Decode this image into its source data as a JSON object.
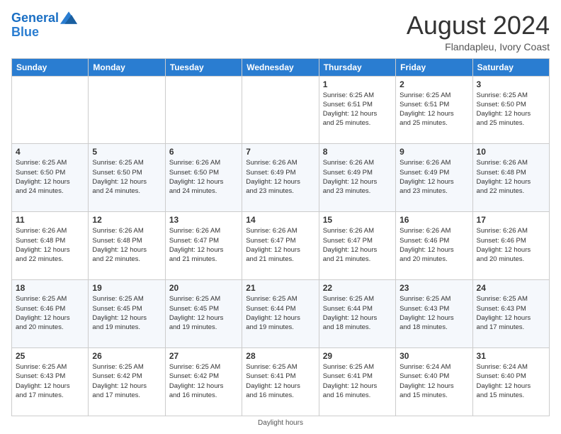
{
  "header": {
    "logo_line1": "General",
    "logo_line2": "Blue",
    "month_year": "August 2024",
    "location": "Flandapleu, Ivory Coast"
  },
  "days_of_week": [
    "Sunday",
    "Monday",
    "Tuesday",
    "Wednesday",
    "Thursday",
    "Friday",
    "Saturday"
  ],
  "weeks": [
    [
      {
        "day": "",
        "info": ""
      },
      {
        "day": "",
        "info": ""
      },
      {
        "day": "",
        "info": ""
      },
      {
        "day": "",
        "info": ""
      },
      {
        "day": "1",
        "info": "Sunrise: 6:25 AM\nSunset: 6:51 PM\nDaylight: 12 hours\nand 25 minutes."
      },
      {
        "day": "2",
        "info": "Sunrise: 6:25 AM\nSunset: 6:51 PM\nDaylight: 12 hours\nand 25 minutes."
      },
      {
        "day": "3",
        "info": "Sunrise: 6:25 AM\nSunset: 6:50 PM\nDaylight: 12 hours\nand 25 minutes."
      }
    ],
    [
      {
        "day": "4",
        "info": "Sunrise: 6:25 AM\nSunset: 6:50 PM\nDaylight: 12 hours\nand 24 minutes."
      },
      {
        "day": "5",
        "info": "Sunrise: 6:25 AM\nSunset: 6:50 PM\nDaylight: 12 hours\nand 24 minutes."
      },
      {
        "day": "6",
        "info": "Sunrise: 6:26 AM\nSunset: 6:50 PM\nDaylight: 12 hours\nand 24 minutes."
      },
      {
        "day": "7",
        "info": "Sunrise: 6:26 AM\nSunset: 6:49 PM\nDaylight: 12 hours\nand 23 minutes."
      },
      {
        "day": "8",
        "info": "Sunrise: 6:26 AM\nSunset: 6:49 PM\nDaylight: 12 hours\nand 23 minutes."
      },
      {
        "day": "9",
        "info": "Sunrise: 6:26 AM\nSunset: 6:49 PM\nDaylight: 12 hours\nand 23 minutes."
      },
      {
        "day": "10",
        "info": "Sunrise: 6:26 AM\nSunset: 6:48 PM\nDaylight: 12 hours\nand 22 minutes."
      }
    ],
    [
      {
        "day": "11",
        "info": "Sunrise: 6:26 AM\nSunset: 6:48 PM\nDaylight: 12 hours\nand 22 minutes."
      },
      {
        "day": "12",
        "info": "Sunrise: 6:26 AM\nSunset: 6:48 PM\nDaylight: 12 hours\nand 22 minutes."
      },
      {
        "day": "13",
        "info": "Sunrise: 6:26 AM\nSunset: 6:47 PM\nDaylight: 12 hours\nand 21 minutes."
      },
      {
        "day": "14",
        "info": "Sunrise: 6:26 AM\nSunset: 6:47 PM\nDaylight: 12 hours\nand 21 minutes."
      },
      {
        "day": "15",
        "info": "Sunrise: 6:26 AM\nSunset: 6:47 PM\nDaylight: 12 hours\nand 21 minutes."
      },
      {
        "day": "16",
        "info": "Sunrise: 6:26 AM\nSunset: 6:46 PM\nDaylight: 12 hours\nand 20 minutes."
      },
      {
        "day": "17",
        "info": "Sunrise: 6:26 AM\nSunset: 6:46 PM\nDaylight: 12 hours\nand 20 minutes."
      }
    ],
    [
      {
        "day": "18",
        "info": "Sunrise: 6:25 AM\nSunset: 6:46 PM\nDaylight: 12 hours\nand 20 minutes."
      },
      {
        "day": "19",
        "info": "Sunrise: 6:25 AM\nSunset: 6:45 PM\nDaylight: 12 hours\nand 19 minutes."
      },
      {
        "day": "20",
        "info": "Sunrise: 6:25 AM\nSunset: 6:45 PM\nDaylight: 12 hours\nand 19 minutes."
      },
      {
        "day": "21",
        "info": "Sunrise: 6:25 AM\nSunset: 6:44 PM\nDaylight: 12 hours\nand 19 minutes."
      },
      {
        "day": "22",
        "info": "Sunrise: 6:25 AM\nSunset: 6:44 PM\nDaylight: 12 hours\nand 18 minutes."
      },
      {
        "day": "23",
        "info": "Sunrise: 6:25 AM\nSunset: 6:43 PM\nDaylight: 12 hours\nand 18 minutes."
      },
      {
        "day": "24",
        "info": "Sunrise: 6:25 AM\nSunset: 6:43 PM\nDaylight: 12 hours\nand 17 minutes."
      }
    ],
    [
      {
        "day": "25",
        "info": "Sunrise: 6:25 AM\nSunset: 6:43 PM\nDaylight: 12 hours\nand 17 minutes."
      },
      {
        "day": "26",
        "info": "Sunrise: 6:25 AM\nSunset: 6:42 PM\nDaylight: 12 hours\nand 17 minutes."
      },
      {
        "day": "27",
        "info": "Sunrise: 6:25 AM\nSunset: 6:42 PM\nDaylight: 12 hours\nand 16 minutes."
      },
      {
        "day": "28",
        "info": "Sunrise: 6:25 AM\nSunset: 6:41 PM\nDaylight: 12 hours\nand 16 minutes."
      },
      {
        "day": "29",
        "info": "Sunrise: 6:25 AM\nSunset: 6:41 PM\nDaylight: 12 hours\nand 16 minutes."
      },
      {
        "day": "30",
        "info": "Sunrise: 6:24 AM\nSunset: 6:40 PM\nDaylight: 12 hours\nand 15 minutes."
      },
      {
        "day": "31",
        "info": "Sunrise: 6:24 AM\nSunset: 6:40 PM\nDaylight: 12 hours\nand 15 minutes."
      }
    ]
  ],
  "footer": {
    "daylight_label": "Daylight hours"
  }
}
